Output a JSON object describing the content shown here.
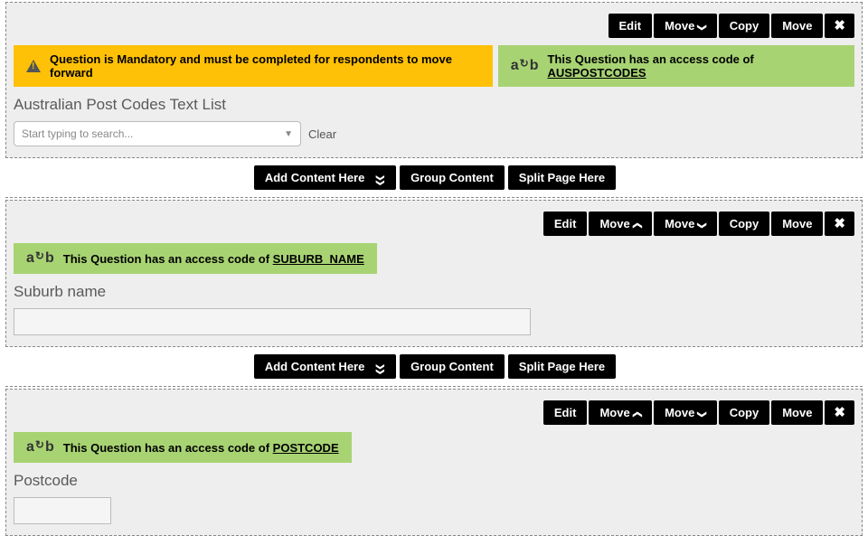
{
  "section1": {
    "toolbar": {
      "edit": "Edit",
      "move": "Move",
      "copy": "Copy",
      "move2": "Move"
    },
    "mandatory_text": "Question is Mandatory and must be completed for respondents to move forward",
    "access_prefix": "This Question has an access code of ",
    "access_code": "AUSPOSTCODES",
    "question_title": "Australian Post Codes Text List",
    "placeholder": "Start typing to search...",
    "clear": "Clear"
  },
  "actions": {
    "add_content": "Add Content Here",
    "group_content": "Group Content",
    "split_page": "Split Page Here"
  },
  "section2": {
    "toolbar": {
      "edit": "Edit",
      "move_up": "Move",
      "move_down": "Move",
      "copy": "Copy",
      "move2": "Move"
    },
    "access_prefix": "This Question has an access code of ",
    "access_code": "SUBURB_NAME",
    "question_title": "Suburb name"
  },
  "section3": {
    "toolbar": {
      "edit": "Edit",
      "move_up": "Move",
      "move_down": "Move",
      "copy": "Copy",
      "move2": "Move"
    },
    "access_prefix": "This Question has an access code of ",
    "access_code": "POSTCODE",
    "question_title": "Postcode"
  }
}
